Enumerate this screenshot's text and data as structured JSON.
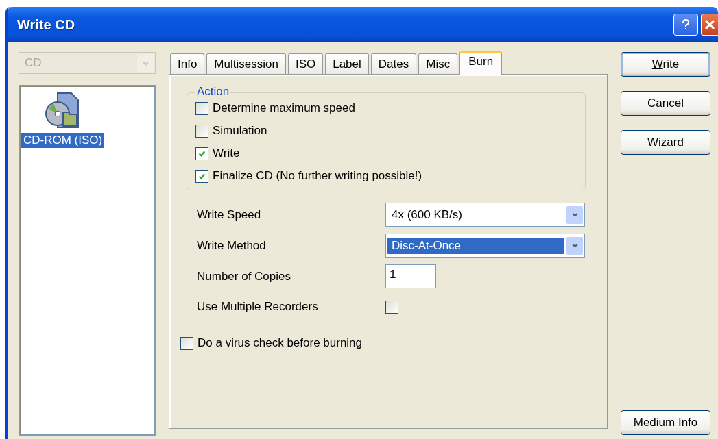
{
  "window": {
    "title": "Write CD"
  },
  "device_dropdown": {
    "value": "CD",
    "disabled": true
  },
  "media_list": {
    "items": [
      {
        "label": "CD-ROM (ISO)",
        "selected": true
      }
    ]
  },
  "tabs": [
    {
      "label": "Info",
      "selected": false
    },
    {
      "label": "Multisession",
      "selected": false
    },
    {
      "label": "ISO",
      "selected": false
    },
    {
      "label": "Label",
      "selected": false
    },
    {
      "label": "Dates",
      "selected": false
    },
    {
      "label": "Misc",
      "selected": false
    },
    {
      "label": "Burn",
      "selected": true
    }
  ],
  "action_group": {
    "title": "Action",
    "options": [
      {
        "label": "Determine maximum speed",
        "checked": false
      },
      {
        "label": "Simulation",
        "checked": false
      },
      {
        "label": "Write",
        "checked": true
      },
      {
        "label": "Finalize CD (No further writing possible!)",
        "checked": true
      }
    ]
  },
  "settings": [
    {
      "kind": "dropdown",
      "label": "Write Speed",
      "value": "4x (600 KB/s)",
      "highlighted": false
    },
    {
      "kind": "dropdown",
      "label": "Write Method",
      "value": "Disc-At-Once",
      "highlighted": true
    },
    {
      "kind": "field",
      "label": "Number of Copies",
      "value": "1"
    },
    {
      "kind": "checkbox",
      "label": "Use Multiple Recorders",
      "checked": false
    }
  ],
  "virus_check": {
    "label": "Do a virus check before burning",
    "checked": false
  },
  "buttons": [
    {
      "label": "Write",
      "default": true,
      "underline_first": true
    },
    {
      "label": "Cancel",
      "default": false,
      "underline_first": false
    },
    {
      "label": "Wizard",
      "default": false,
      "underline_first": false
    }
  ],
  "medium_info_button": {
    "label": "Medium Info"
  }
}
